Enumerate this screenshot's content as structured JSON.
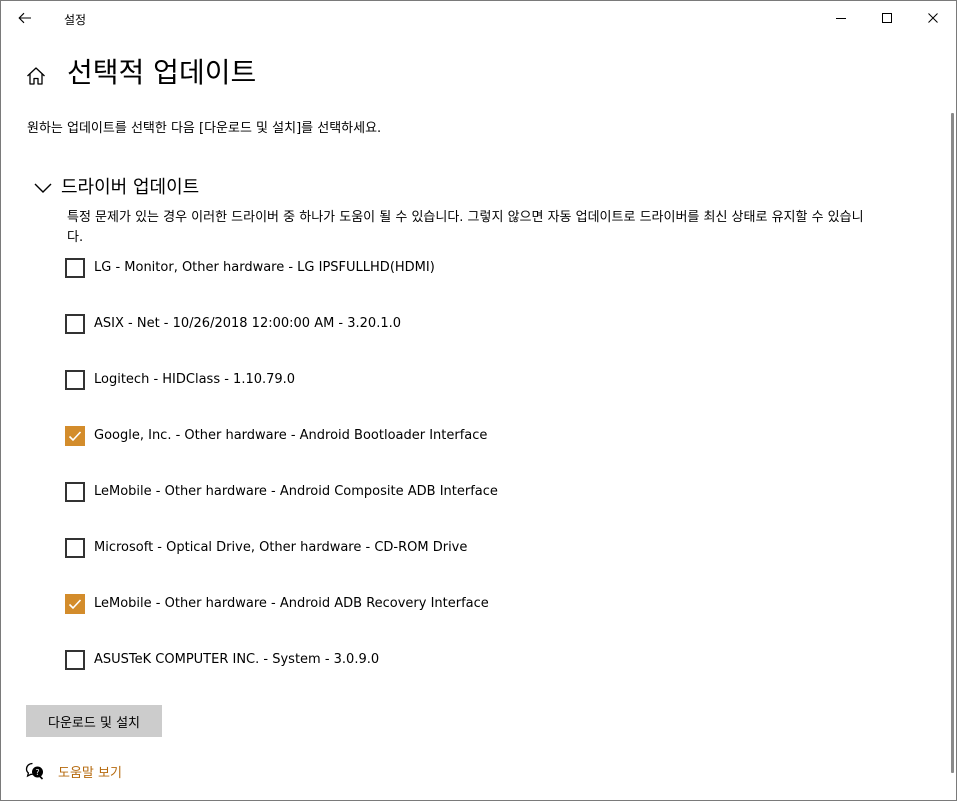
{
  "window": {
    "app_title": "설정"
  },
  "header": {
    "title": "선택적 업데이트",
    "instruction": "원하는 업데이트를 선택한 다음 [다운로드 및 설치]를 선택하세요."
  },
  "section": {
    "title": "드라이버 업데이트",
    "description": "특정 문제가 있는 경우 이러한 드라이버 중 하나가 도움이 될 수 있습니다. 그렇지 않으면 자동 업데이트로 드라이버를 최신 상태로 유지할 수 있습니다."
  },
  "drivers": [
    {
      "label": "LG - Monitor, Other hardware - LG IPSFULLHD(HDMI)",
      "checked": false
    },
    {
      "label": "ASIX - Net - 10/26/2018 12:00:00 AM - 3.20.1.0",
      "checked": false
    },
    {
      "label": "Logitech - HIDClass - 1.10.79.0",
      "checked": false
    },
    {
      "label": "Google, Inc. - Other hardware - Android Bootloader Interface",
      "checked": true
    },
    {
      "label": "LeMobile - Other hardware - Android Composite ADB Interface",
      "checked": false
    },
    {
      "label": "Microsoft - Optical Drive, Other hardware - CD-ROM Drive",
      "checked": false
    },
    {
      "label": "LeMobile - Other hardware - Android ADB Recovery Interface",
      "checked": true
    },
    {
      "label": "ASUSTeK COMPUTER INC. - System - 3.0.9.0",
      "checked": false
    }
  ],
  "actions": {
    "install_label": "다운로드 및 설치"
  },
  "help": {
    "label": "도움말 보기"
  },
  "colors": {
    "accent": "#d38c2b",
    "link": "#b66a0e",
    "button_bg": "#cccccc"
  }
}
